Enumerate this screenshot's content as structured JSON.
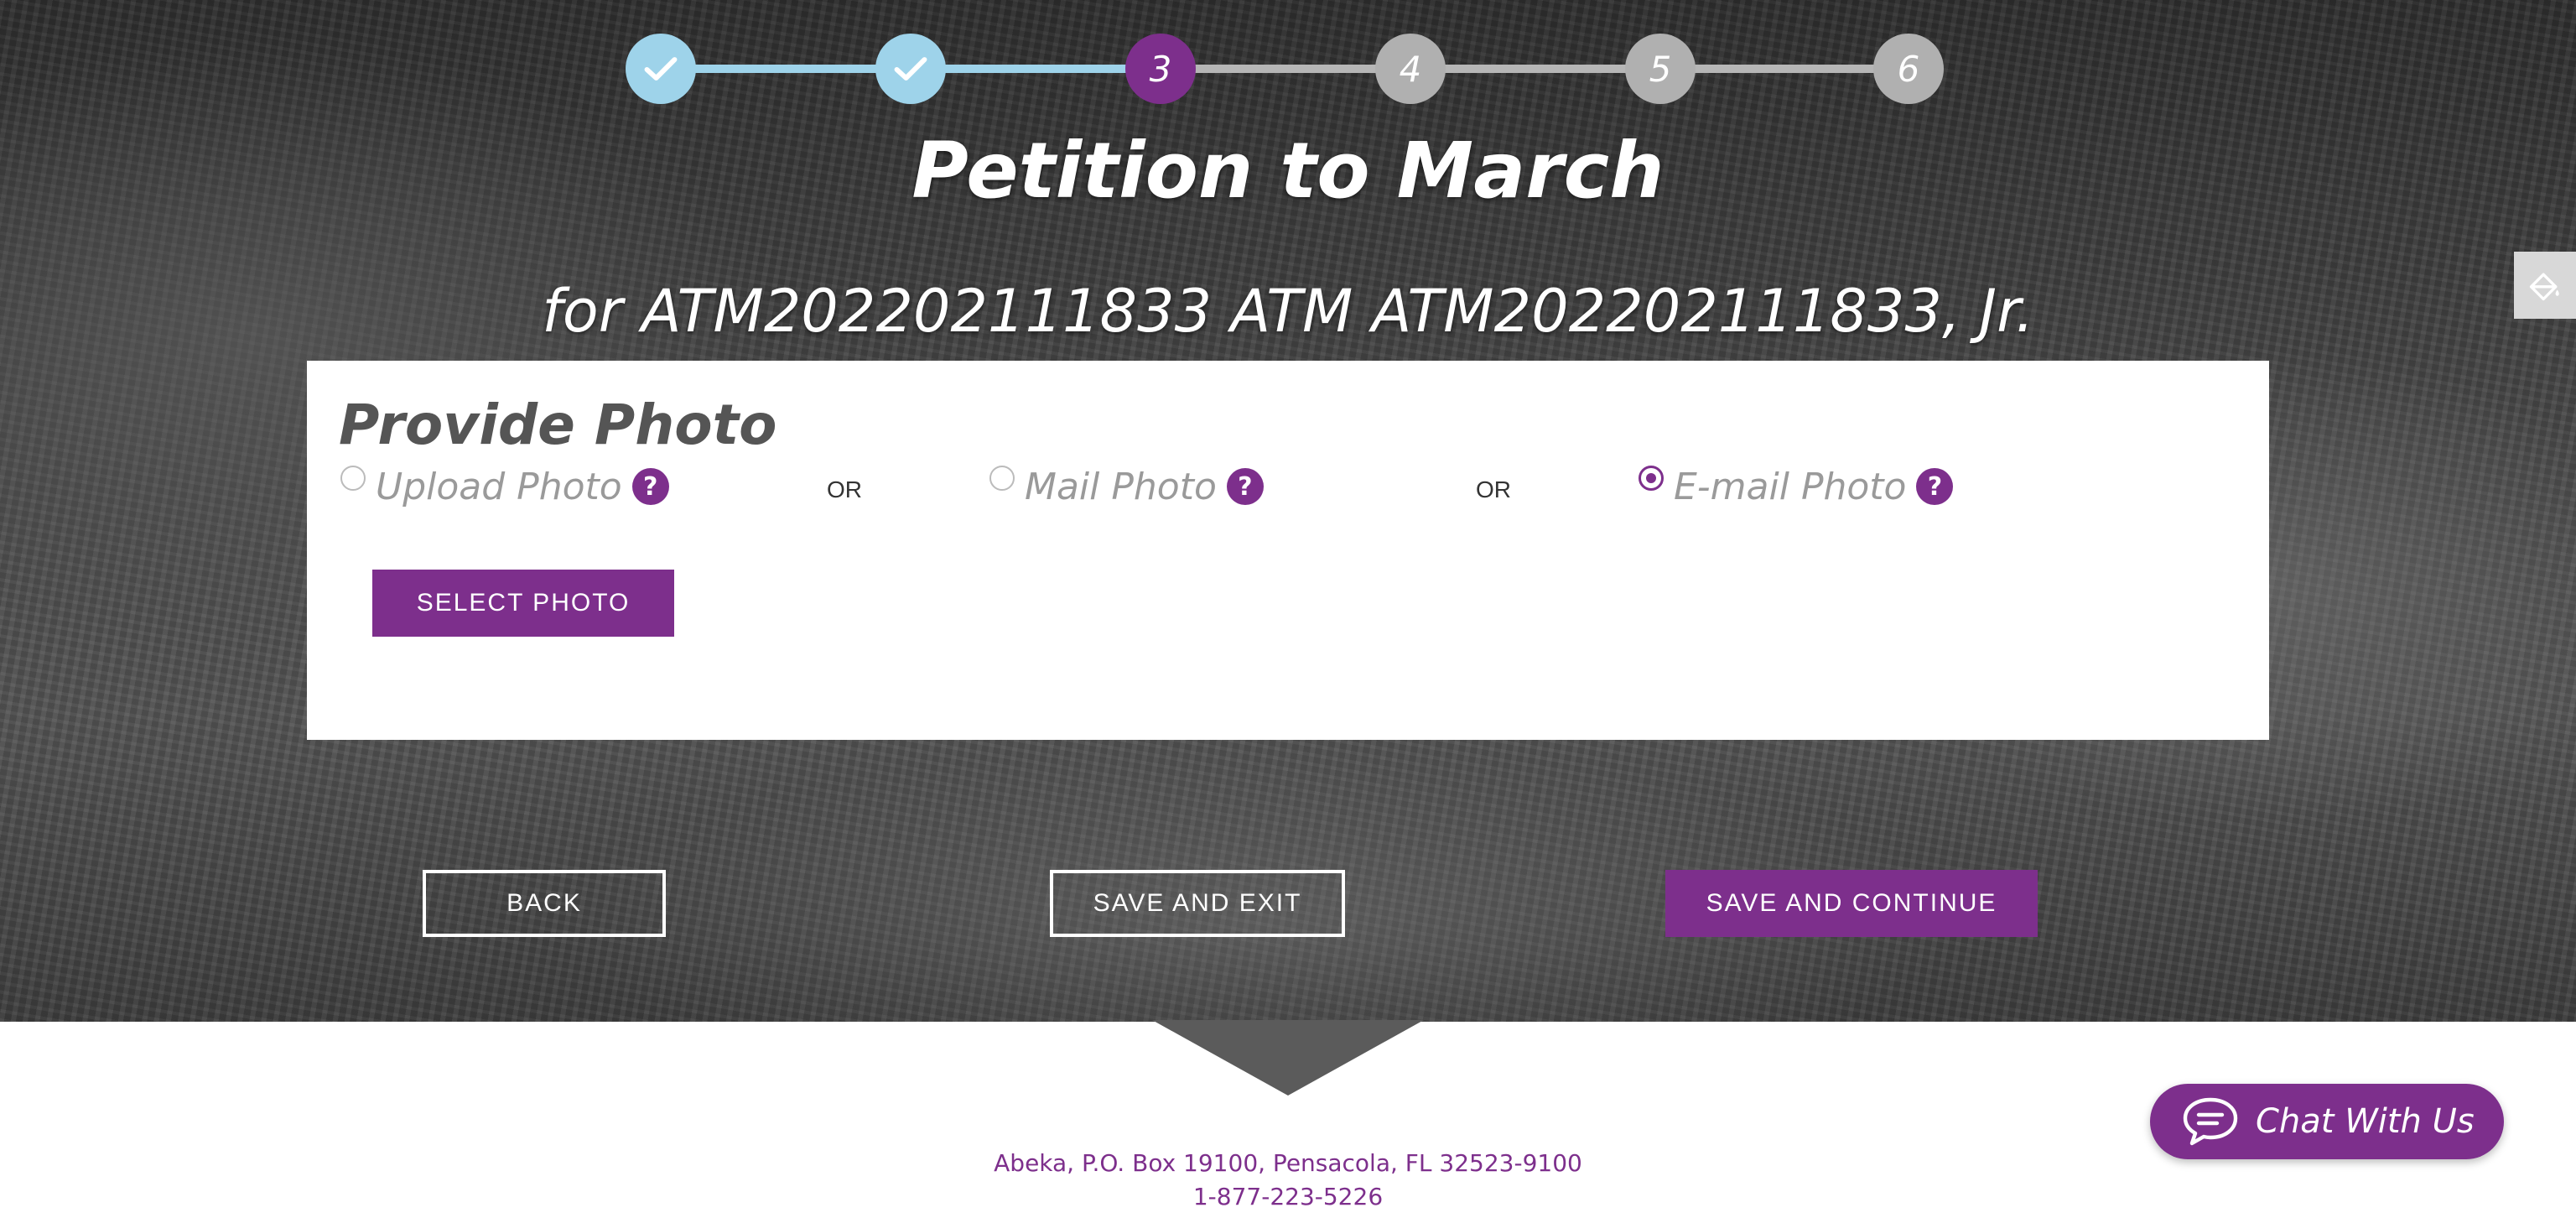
{
  "stepper": {
    "steps": [
      {
        "label": "",
        "state": "done"
      },
      {
        "label": "",
        "state": "done"
      },
      {
        "label": "3",
        "state": "current"
      },
      {
        "label": "4",
        "state": "todo"
      },
      {
        "label": "5",
        "state": "todo"
      },
      {
        "label": "6",
        "state": "todo"
      }
    ]
  },
  "header": {
    "title": "Petition to March",
    "subtitle": "for ATM202202111833 ATM ATM202202111833, Jr."
  },
  "photo_card": {
    "title": "Provide Photo",
    "options": [
      {
        "label": "Upload Photo",
        "selected": false
      },
      {
        "label": "Mail Photo",
        "selected": false
      },
      {
        "label": "E-mail Photo",
        "selected": true
      }
    ],
    "or_label": "OR",
    "help_glyph": "?",
    "select_button": "SELECT PHOTO"
  },
  "actions": {
    "back": "BACK",
    "save_exit": "SAVE AND EXIT",
    "save_continue": "SAVE AND CONTINUE"
  },
  "footer": {
    "address": "Abeka, P.O. Box 19100, Pensacola, FL  32523-9100",
    "phone": "1-877-223-5226"
  },
  "chat": {
    "label": "Chat With Us"
  },
  "colors": {
    "brand_purple": "#7d2f8c",
    "step_done": "#9ed3ea",
    "step_todo": "#b0b0b0"
  },
  "icons": {
    "step_done": "checkmark-icon",
    "help": "question-icon",
    "chat": "speech-bubble-icon",
    "side_tab": "paint-bucket-icon"
  }
}
